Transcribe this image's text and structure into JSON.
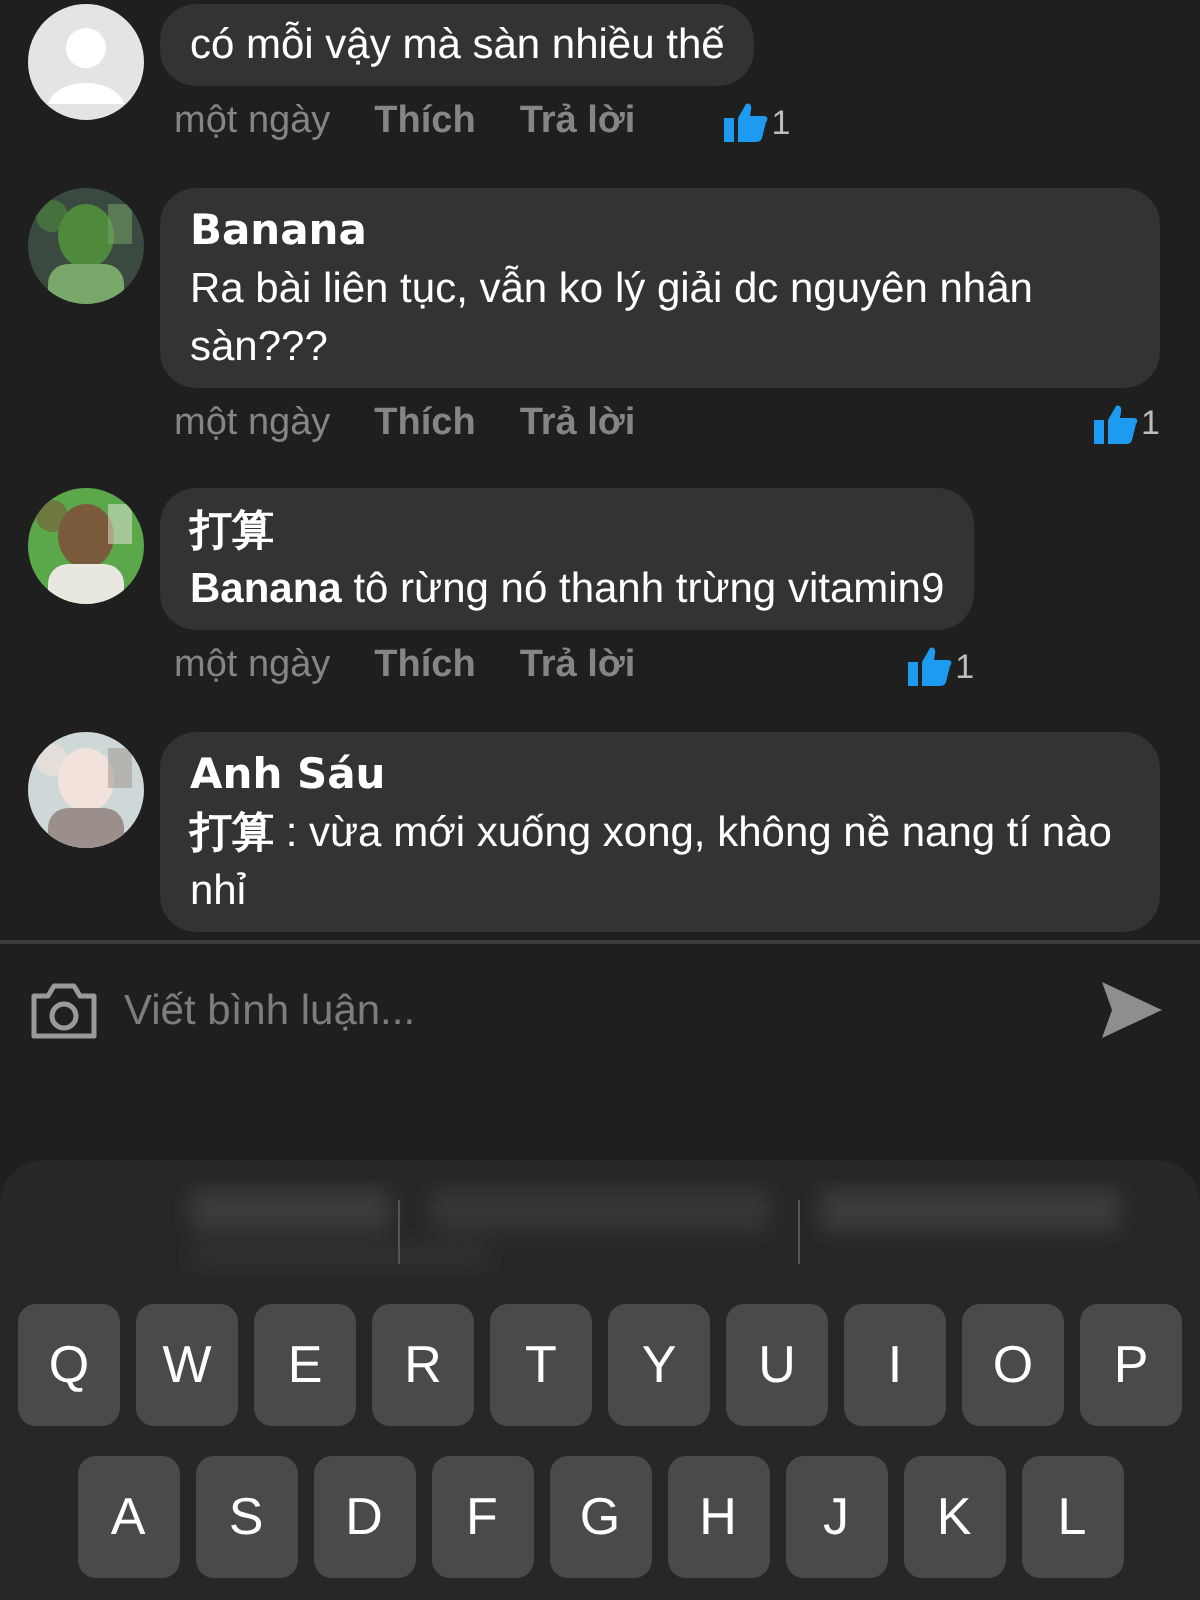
{
  "comments": [
    {
      "avatar": {
        "kind": "silhouette"
      },
      "text": "có mỗi vậy mà sàn nhiều thế",
      "time": "một ngày",
      "like_label": "Thích",
      "reply_label": "Trả lời",
      "reaction_count": "1"
    },
    {
      "author": "Banana",
      "text": "Ra bài liên tục, vẫn ko lý giải dc nguyên nhân sàn???",
      "time": "một ngày",
      "like_label": "Thích",
      "reply_label": "Trả lời",
      "reaction_count": "1"
    },
    {
      "author": "打算",
      "text": "**Banana**  tô rừng nó thanh trừng vitamin9",
      "time": "một ngày",
      "like_label": "Thích",
      "reply_label": "Trả lời",
      "reaction_count": "1"
    },
    {
      "author": "Anh Sáu",
      "text": "**打算**  : vừa mới xuống xong, không nề nang tí nào nhỉ"
    }
  ],
  "composer": {
    "placeholder": "Viết bình luận..."
  },
  "keyboard": {
    "rows": [
      [
        "Q",
        "W",
        "E",
        "R",
        "T",
        "Y",
        "U",
        "I",
        "O",
        "P"
      ],
      [
        "A",
        "S",
        "D",
        "F",
        "G",
        "H",
        "J",
        "K",
        "L"
      ]
    ]
  }
}
